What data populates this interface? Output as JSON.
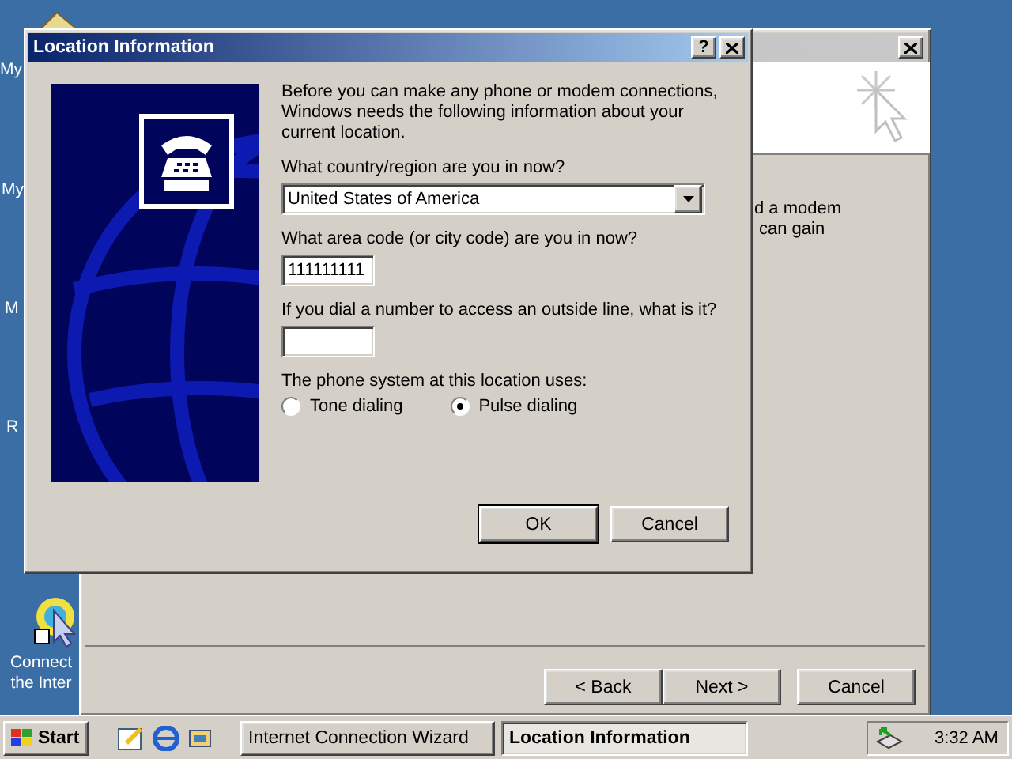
{
  "desktop": {
    "icons": [
      {
        "label": "My"
      },
      {
        "label": "My"
      },
      {
        "label": "M"
      },
      {
        "label": "R"
      },
      {
        "label": "Connect the Inter"
      }
    ]
  },
  "wizard": {
    "body_lines": [
      "d a modem",
      "can gain"
    ],
    "buttons": [
      "< Back",
      "Next >",
      "Cancel"
    ]
  },
  "dialog": {
    "title": "Location Information",
    "help": "?",
    "intro": "Before you can make any phone or modem connections, Windows needs the following information about your current location.",
    "country_label": "What country/region are you in now?",
    "country_value": "United States of America",
    "area_label": "What area code (or city code) are you in now?",
    "area_value": "111111111",
    "outside_label": "If you dial a number to access an outside line, what is it?",
    "system_label": "The phone system at this location uses:",
    "radios": [
      {
        "label": "Tone dialing",
        "selected": false
      },
      {
        "label": "Pulse dialing",
        "selected": true
      }
    ],
    "buttons": [
      {
        "label": "OK",
        "default": true
      },
      {
        "label": "Cancel",
        "default": false
      }
    ]
  },
  "taskbar": {
    "start": "Start",
    "tasks": [
      {
        "label": "Internet Connection Wizard",
        "selected": false
      },
      {
        "label": "Location Information",
        "selected": true
      }
    ],
    "clock": "3:32 AM"
  }
}
